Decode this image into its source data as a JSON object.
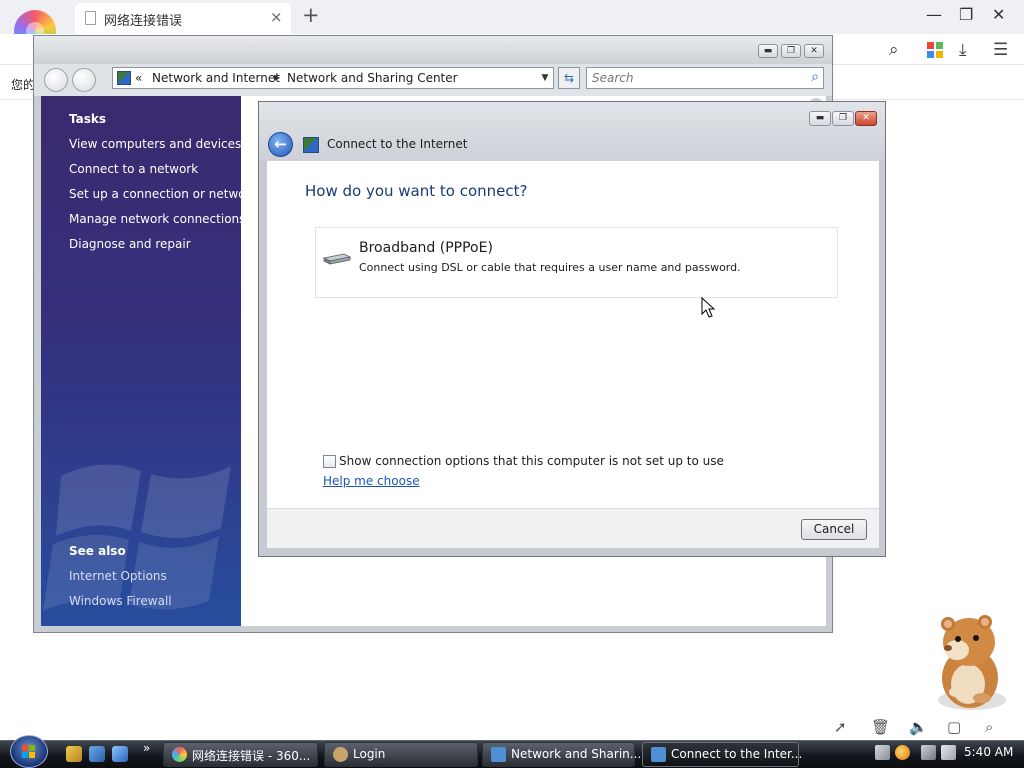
{
  "browser": {
    "tab_title": "网络连接错误",
    "tab_close": "×",
    "new_tab": "+",
    "page_text": "您的",
    "window_controls": {
      "minimize": "—",
      "restore": "❐",
      "close": "✕"
    },
    "toolbar_icons": {
      "search": "⌕",
      "download": "⤓",
      "menu": "☰"
    }
  },
  "nsc_window": {
    "breadcrumb": {
      "prefix": "«",
      "items": [
        "Network and Internet",
        "Network and Sharing Center"
      ]
    },
    "search_placeholder": "Search",
    "sidebar": {
      "tasks_heading": "Tasks",
      "tasks": [
        "View computers and devices",
        "Connect to a network",
        "Set up a connection or network",
        "Manage network connections",
        "Diagnose and repair"
      ],
      "see_also_heading": "See also",
      "see_also": [
        "Internet Options",
        "Windows Firewall"
      ]
    }
  },
  "dialog": {
    "title": "Connect to the Internet",
    "question": "How do you want to connect?",
    "option": {
      "title": "Broadband (PPPoE)",
      "description": "Connect using DSL or cable that requires a user name and password."
    },
    "checkbox_label": "Show connection options that this computer is not set up to use",
    "help_link": "Help me choose",
    "cancel_label": "Cancel"
  },
  "taskbar": {
    "quick_launch_more": "»",
    "buttons": [
      {
        "label": "网络连接错误 - 360...",
        "icon_color": "#e9a24a"
      },
      {
        "label": "Login",
        "icon_color": "#c9a46a"
      },
      {
        "label": "Network and Sharin...",
        "icon_color": "#4f8fd6"
      },
      {
        "label": "Connect to the Inter...",
        "icon_color": "#4f8fd6"
      }
    ],
    "clock": "5:40 AM"
  },
  "colors": {
    "sidebar_top": "#3b2a6e",
    "sidebar_bottom": "#274d9e",
    "question_blue": "#1a3a78",
    "link_blue": "#1a56b8"
  }
}
